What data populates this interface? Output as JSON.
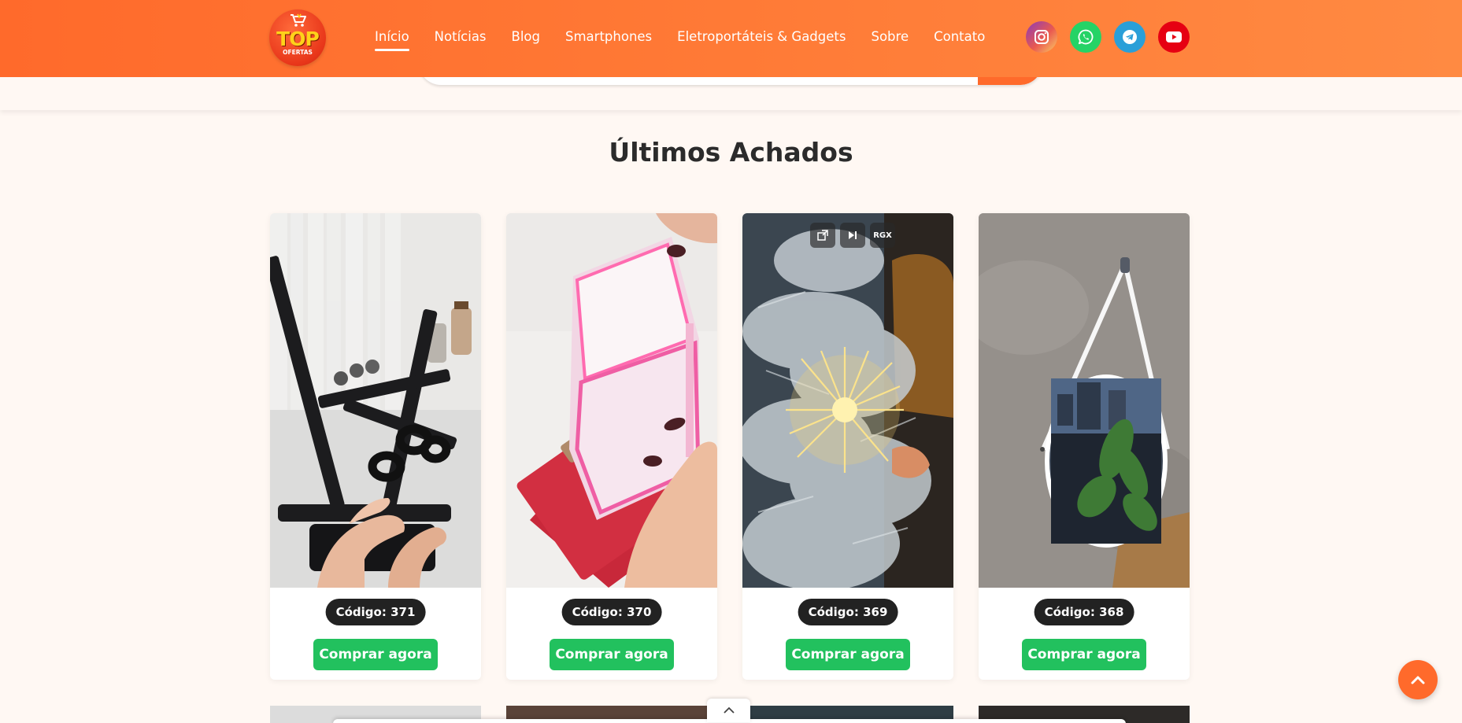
{
  "brand": {
    "logo_top": "TOP",
    "logo_sub": "OFERTAS"
  },
  "nav": [
    {
      "label": "Início",
      "active": true
    },
    {
      "label": "Notícias"
    },
    {
      "label": "Blog"
    },
    {
      "label": "Smartphones"
    },
    {
      "label": "Eletroportáteis & Gadgets"
    },
    {
      "label": "Sobre"
    },
    {
      "label": "Contato"
    }
  ],
  "socials": [
    {
      "icon": "instagram-icon",
      "color": "#e1306c"
    },
    {
      "icon": "whatsapp-icon",
      "color": "#25d366"
    },
    {
      "icon": "telegram-icon",
      "color": "#2a9fd8"
    },
    {
      "icon": "youtube-icon",
      "color": "#e60012"
    }
  ],
  "section": {
    "title": "Últimos Achados"
  },
  "products": [
    {
      "code": "Código: 371",
      "button": "Comprar agora",
      "image": "black foldable phone stand held in hands"
    },
    {
      "code": "Código: 370",
      "button": "Comprar agora",
      "image": "pink card holder with red card"
    },
    {
      "code": "Código: 369",
      "button": "Comprar agora",
      "image": "frosted christmas tree with starburst lights",
      "video_controls": [
        "popout-icon",
        "skip-icon",
        "RGX"
      ]
    },
    {
      "code": "Código: 368",
      "button": "Comprar agora",
      "image": "round mirror with white strap on concrete wall"
    }
  ],
  "colors": {
    "header_start": "#ff6a2b",
    "header_end": "#ff8a42",
    "buy_button": "#22c15e",
    "code_badge": "#222222",
    "page_bg": "#fff8f3"
  }
}
